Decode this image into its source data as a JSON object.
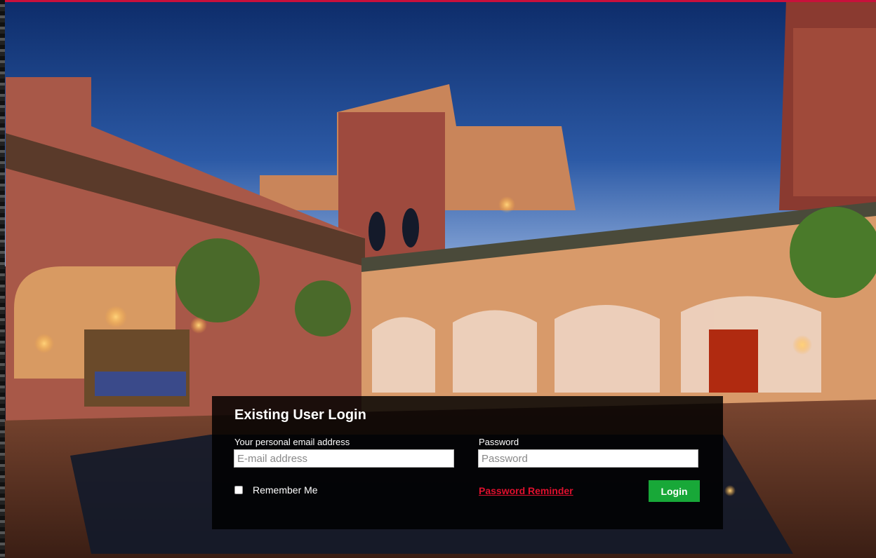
{
  "login": {
    "title": "Existing User Login",
    "email_label": "Your personal email address",
    "email_placeholder": "E-mail address",
    "email_value": "",
    "password_label": "Password",
    "password_placeholder": "Password",
    "password_value": "",
    "remember_label": "Remember Me",
    "remember_checked": false,
    "reminder_label": "Password Reminder",
    "submit_label": "Login"
  },
  "colors": {
    "panel_background": "#000000",
    "login_button": "#18a838",
    "reminder_link": "#e0102e",
    "top_accent": "#c8103c"
  }
}
